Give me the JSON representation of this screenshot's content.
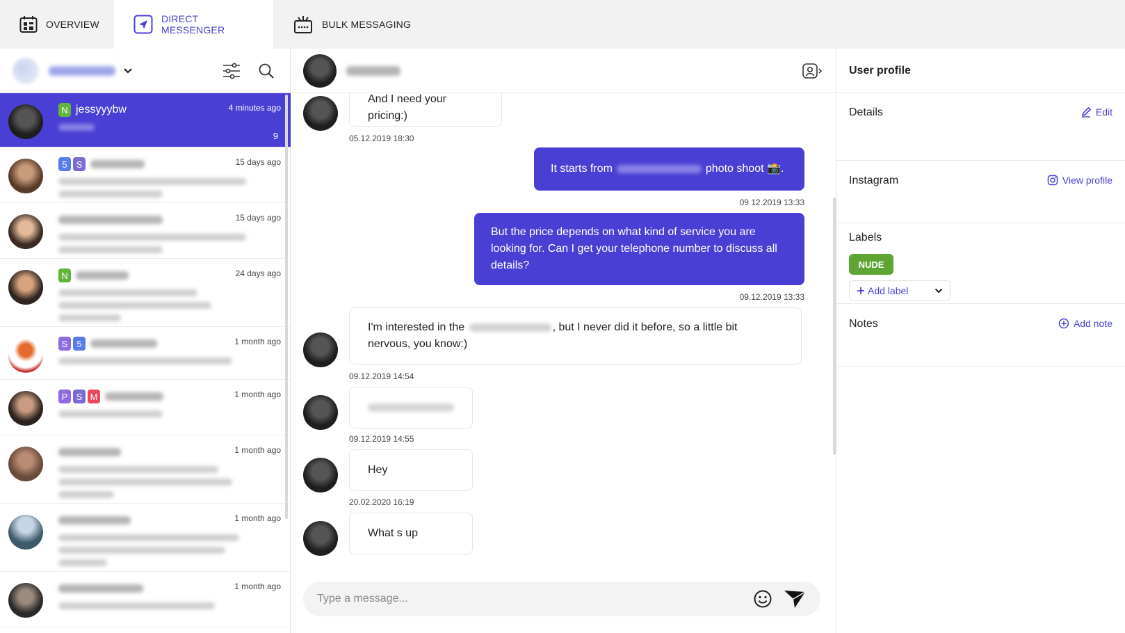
{
  "tabs": [
    {
      "label": "OVERVIEW"
    },
    {
      "label": "DIRECT MESSENGER",
      "active": true
    },
    {
      "label": "BULK MESSAGING"
    }
  ],
  "colors": {
    "accent": "#4a3fd4",
    "label_green": "#5fa533"
  },
  "conversations": [
    {
      "name": "jessyyybw",
      "time": "4 minutes ago",
      "unread": "9",
      "badges": [
        "N"
      ],
      "active": true
    },
    {
      "time": "15 days ago",
      "badges": [
        "5",
        "S"
      ]
    },
    {
      "time": "15 days ago",
      "badges": []
    },
    {
      "time": "24 days ago",
      "badges": [
        "N"
      ]
    },
    {
      "time": "1 month ago",
      "badges": [
        "S",
        "5"
      ]
    },
    {
      "time": "1 month ago",
      "badges": [
        "P",
        "S",
        "M"
      ]
    },
    {
      "time": "1 month ago",
      "badges": []
    },
    {
      "time": "1 month ago",
      "badges": []
    },
    {
      "time": "1 month ago",
      "badges": []
    }
  ],
  "chat": {
    "messages": [
      {
        "dir": "in",
        "text": "And I need your pricing:)",
        "time": "05.12.2019 18:30"
      },
      {
        "dir": "out",
        "text_before": "It starts from",
        "text_after": "photo shoot 📸.",
        "time": "09.12.2019 13:33"
      },
      {
        "dir": "out",
        "text": "But the price depends on what kind of service you are looking for. Can I get your telephone number to discuss all details?",
        "time": "09.12.2019 13:33"
      },
      {
        "dir": "in",
        "text_before": "I'm interested in the",
        "text_after": ", but I never did it before, so a little bit nervous, you know:)",
        "time": "09.12.2019 14:54"
      },
      {
        "dir": "in",
        "text": "",
        "time": "09.12.2019 14:55"
      },
      {
        "dir": "in",
        "text": "Hey",
        "time": "20.02.2020 16:19"
      },
      {
        "dir": "in",
        "text": "What s up",
        "time": ""
      }
    ],
    "composer_placeholder": "Type a message..."
  },
  "profile": {
    "title": "User profile",
    "details": {
      "title": "Details",
      "action": "Edit"
    },
    "instagram": {
      "title": "Instagram",
      "action": "View profile"
    },
    "labels": {
      "title": "Labels",
      "items": [
        "NUDE"
      ],
      "add": "Add label"
    },
    "notes": {
      "title": "Notes",
      "action": "Add note"
    }
  }
}
